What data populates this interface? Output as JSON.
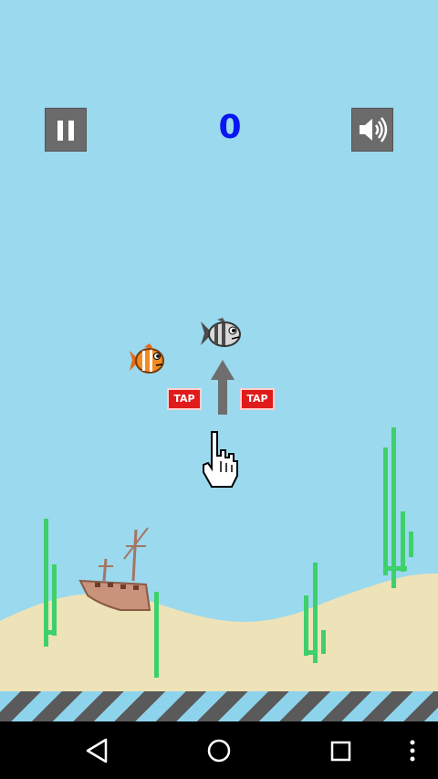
{
  "hud": {
    "score": "0",
    "pause_icon": "pause-icon",
    "sound_icon": "speaker-volume-icon"
  },
  "tutorial": {
    "tap_left_label": "TAP",
    "tap_right_label": "TAP",
    "arrow_icon": "up-arrow-icon",
    "hand_icon": "pointing-hand-icon"
  },
  "scene": {
    "player_fish": "striped-gray-fish",
    "enemy_fish": "orange-clownfish",
    "decor": [
      "seaweed",
      "sunken-ship",
      "sand-dunes",
      "hazard-stripe"
    ]
  },
  "colors": {
    "sky_water": "#9ad9ee",
    "sand": "#ede2b8",
    "seaweed": "#33cc66",
    "score": "#0a16f0",
    "tap_badge": "#e01b1b"
  },
  "navbar": {
    "icons": [
      "back-icon",
      "home-icon",
      "recents-icon",
      "overflow-menu-icon"
    ]
  }
}
